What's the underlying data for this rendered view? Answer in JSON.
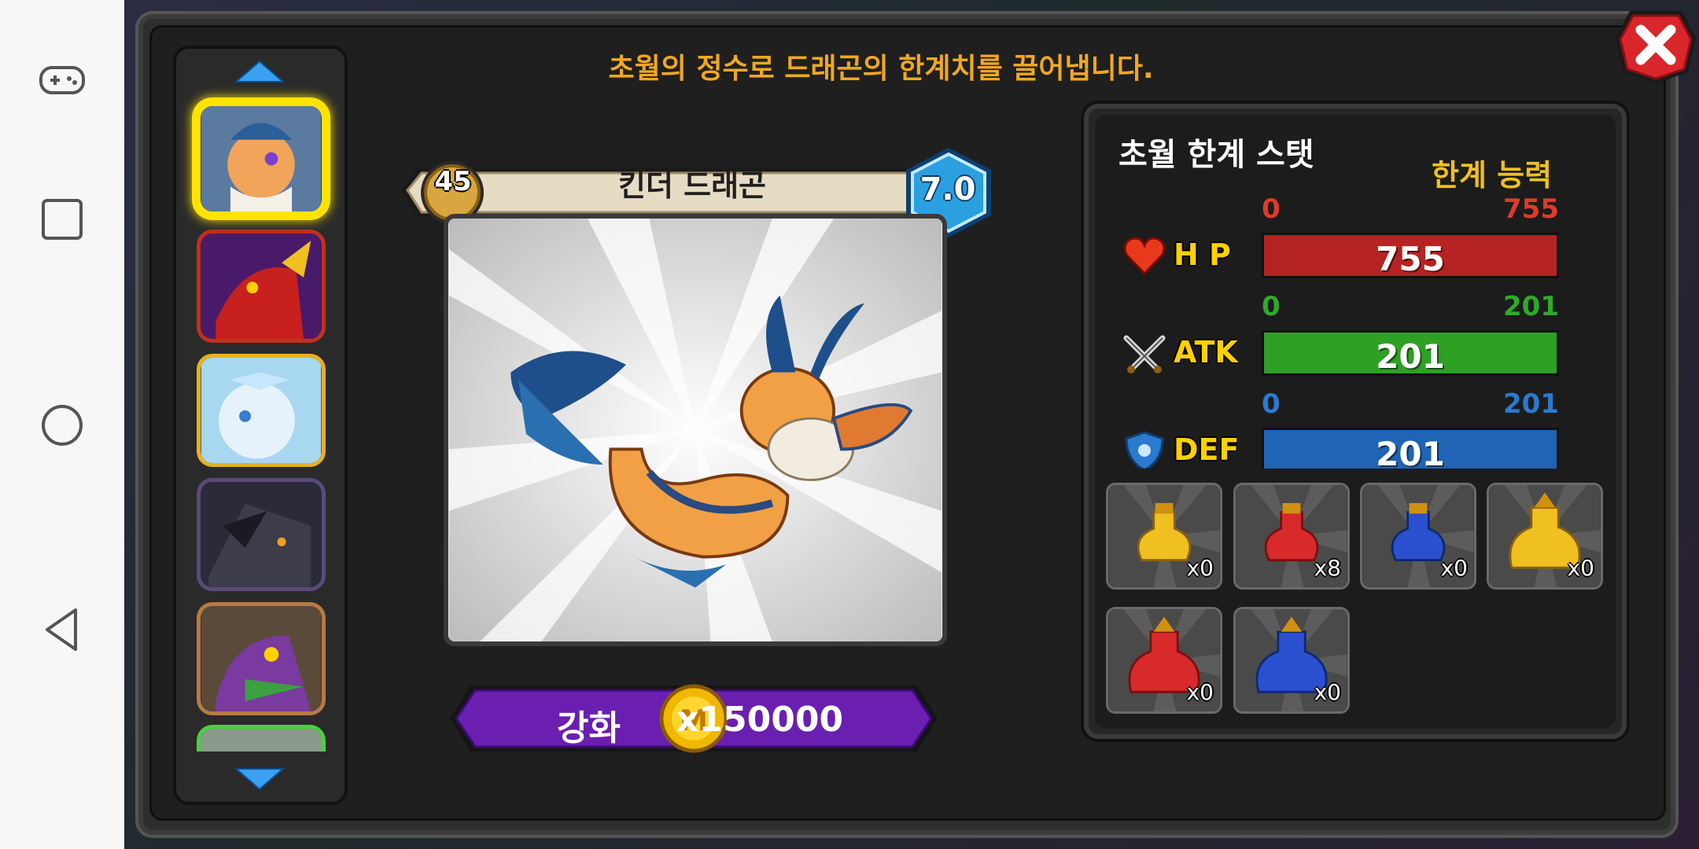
{
  "header": {
    "description": "초월의 정수로 드래곤의 한계치를 끌어냅니다."
  },
  "dragon": {
    "level": "45",
    "name": "킨더 드래곤",
    "grade": "7.0"
  },
  "upgrade": {
    "label": "강화",
    "cost": "x150000",
    "coin_symbol": "M"
  },
  "stats_panel": {
    "title": "초월 한계 스탯",
    "limit_title": "한계 능력",
    "stats": [
      {
        "label": "H P",
        "min": "0",
        "max": "755",
        "value": "755",
        "fill": 1.0,
        "color": "#b52322",
        "range_color": "#e03a2a",
        "icon": "heart-icon"
      },
      {
        "label": "ATK",
        "min": "0",
        "max": "201",
        "value": "201",
        "fill": 1.0,
        "color": "#2ea024",
        "range_color": "#2faa2a",
        "icon": "crossed-swords-icon"
      },
      {
        "label": "DEF",
        "min": "0",
        "max": "201",
        "value": "201",
        "fill": 1.0,
        "color": "#1f64b5",
        "range_color": "#2a7ad0",
        "icon": "shield-icon"
      }
    ]
  },
  "potions": [
    {
      "name": "yellow-potion",
      "count": "x0"
    },
    {
      "name": "red-potion",
      "count": "x8"
    },
    {
      "name": "blue-potion",
      "count": "x0"
    },
    {
      "name": "large-yellow-potion",
      "count": "x0"
    },
    {
      "name": "large-red-potion",
      "count": "x0"
    },
    {
      "name": "large-blue-potion",
      "count": "x0"
    }
  ],
  "dragon_list": [
    {
      "name": "kinder-dragon",
      "selected": true,
      "border": "#ffe400"
    },
    {
      "name": "red-dragon",
      "selected": false,
      "border": "#c0301e"
    },
    {
      "name": "ice-dragon",
      "selected": false,
      "border": "#e8b020"
    },
    {
      "name": "dark-dragon",
      "selected": false,
      "border": "#5a4a7a"
    },
    {
      "name": "purple-dragon",
      "selected": false,
      "border": "#b87a40"
    },
    {
      "name": "green-dragon",
      "selected": false,
      "border": "#4ad040"
    }
  ],
  "colors": {
    "accent_text": "#f0a820",
    "upgrade_button": "#6a1fb0",
    "grade_badge": "#2aa0e0"
  }
}
